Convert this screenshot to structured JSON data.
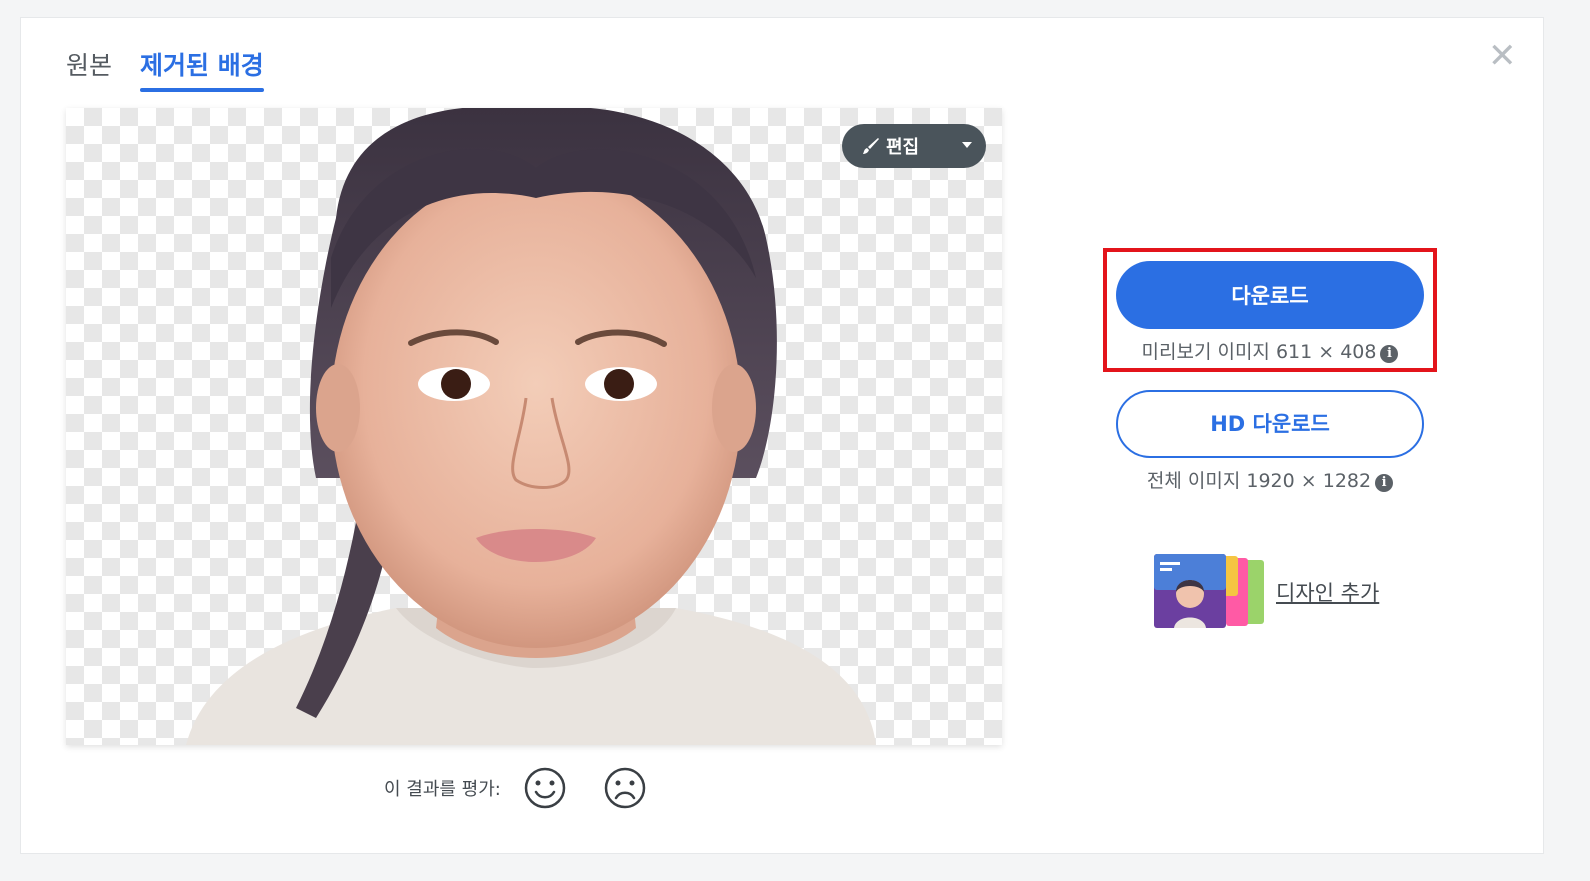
{
  "tabs": [
    {
      "label": "원본",
      "active": false
    },
    {
      "label": "제거된 배경",
      "active": true
    }
  ],
  "close_icon": "close-icon",
  "edit_button": {
    "label": "편집",
    "icon": "brush-icon",
    "menu_icon": "caret-down-icon"
  },
  "rating": {
    "label": "이 결과를 평가:",
    "positive_icon": "smile-icon",
    "negative_icon": "frown-icon"
  },
  "download": {
    "label": "다운로드",
    "info": "미리보기 이미지 611 × 408",
    "info_icon": "info-icon"
  },
  "hd_download": {
    "label": "HD 다운로드",
    "info": "전체 이미지 1920 × 1282",
    "info_icon": "info-icon"
  },
  "design": {
    "link": "디자인 추가",
    "thumbnail_icon": "design-thumbnail-icon"
  },
  "colors": {
    "accent": "#2b6fe3",
    "highlight": "#e3141b",
    "edit_bg": "#4a545b"
  }
}
